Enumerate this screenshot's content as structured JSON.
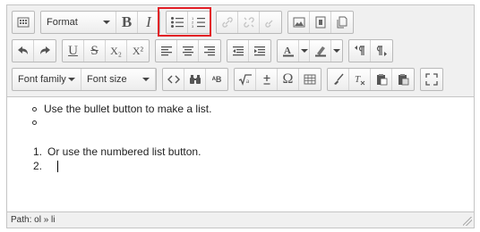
{
  "toolbar": {
    "format_label": "Format",
    "font_family_label": "Font family",
    "font_size_label": "Font size",
    "bold_label": "B",
    "italic_label": "I",
    "underline_label": "U",
    "strikethrough_label": "S",
    "subscript_label": "X₂",
    "superscript_label": "X²",
    "omega_label": "Ω",
    "search_replace_label": "ᴬB"
  },
  "content": {
    "bullet_text": "Use the bullet button to make a list.",
    "numbered_items": [
      {
        "number": "1.",
        "text": "Or use the numbered list button."
      },
      {
        "number": "2.",
        "text": ""
      }
    ]
  },
  "statusbar": {
    "path_text": "Path: ol » li"
  },
  "colors": {
    "highlight": "#e21f26",
    "toolbar_bg": "#f0f0f0",
    "border": "#c5c5c5"
  }
}
